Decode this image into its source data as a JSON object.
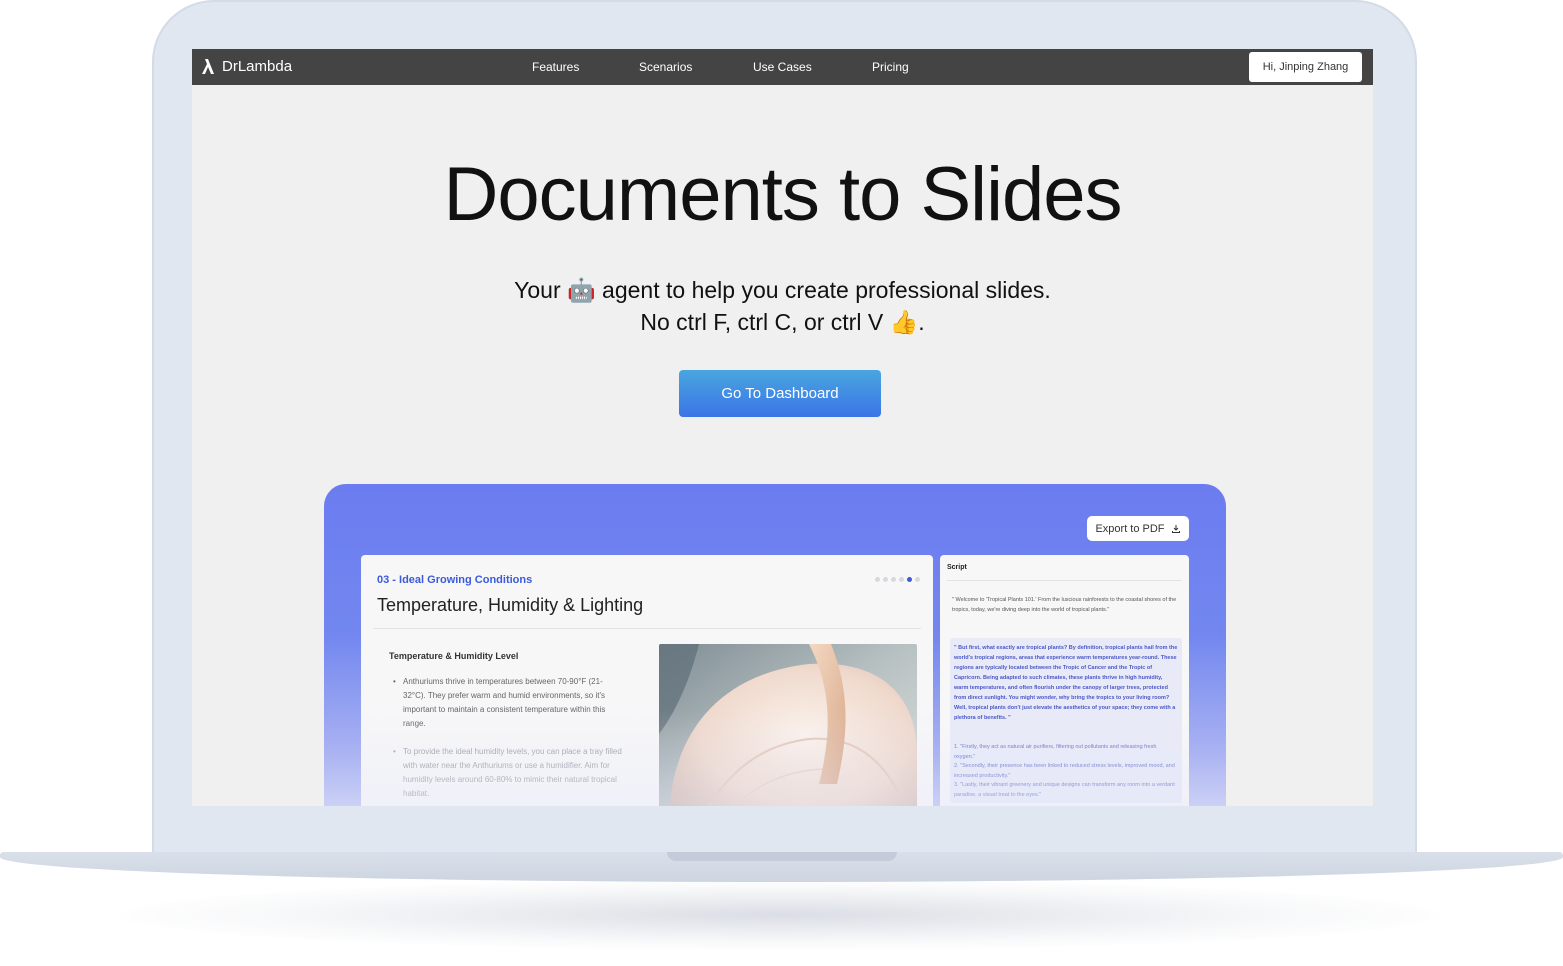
{
  "navbar": {
    "brand": "DrLambda",
    "links": [
      "Features",
      "Scenarios",
      "Use Cases",
      "Pricing"
    ],
    "user_button": "Hi, Jinping Zhang"
  },
  "hero": {
    "title": "Documents to Slides",
    "tagline_line1": "Your 🤖 agent to help you create professional slides.",
    "tagline_line2": "No ctrl F, ctrl C, or ctrl V 👍.",
    "cta_label": "Go To Dashboard"
  },
  "preview": {
    "export_label": "Export to PDF",
    "slide": {
      "section": "03 - Ideal Growing Conditions",
      "title": "Temperature, Humidity & Lighting",
      "subheading": "Temperature & Humidity Level",
      "bullets": [
        "Anthuriums thrive in temperatures between 70-90°F (21-32°C). They prefer warm and humid environments, so it's important to maintain a consistent temperature within this range.",
        "To provide the ideal humidity levels, you can place a tray filled with water near the Anthuriums or use a humidifier. Aim for humidity levels around 60-80% to mimic their natural tropical habitat."
      ],
      "image_alt": "white anthurium plant"
    },
    "script": {
      "label": "Script",
      "intro": "\" Welcome to 'Tropical Plants 101.' From the luscious rainforests to the coastal shores of the tropics, today, we're diving deep into the world of tropical plants.\"",
      "highlight": "\" But first, what exactly are tropical plants? By definition, tropical plants hail from the world's tropical regions, areas that experience warm temperatures year-round. These regions are typically located between the Tropic of Cancer and the Tropic of Capricorn. Being adapted to such climates, these plants thrive in high humidity, warm temperatures, and often flourish under the canopy of larger trees, protected from direct sunlight. You might wonder, why bring the tropics to your living room? Well, tropical plants don't just elevate the aesthetics of your space; they come with a plethora of benefits. \"",
      "list": [
        "1. \"Firstly, they act as natural air purifiers, filtering out pollutants and releasing fresh oxygen.\"",
        "2. \"Secondly, their presence has been linked to reduced stress levels, improved mood, and increased productivity.\"",
        "3. \"Lastly, their vibrant greenery and unique designs can transform any room into a verdant paradise, a visual treat to the eyes.\""
      ]
    }
  },
  "colors": {
    "navbar_bg": "#444444",
    "cta_gradient_top": "#49a6df",
    "cta_gradient_bottom": "#3b74e6",
    "showcase_accent": "#6b7cf0",
    "section_accent": "#3b5bd9"
  }
}
